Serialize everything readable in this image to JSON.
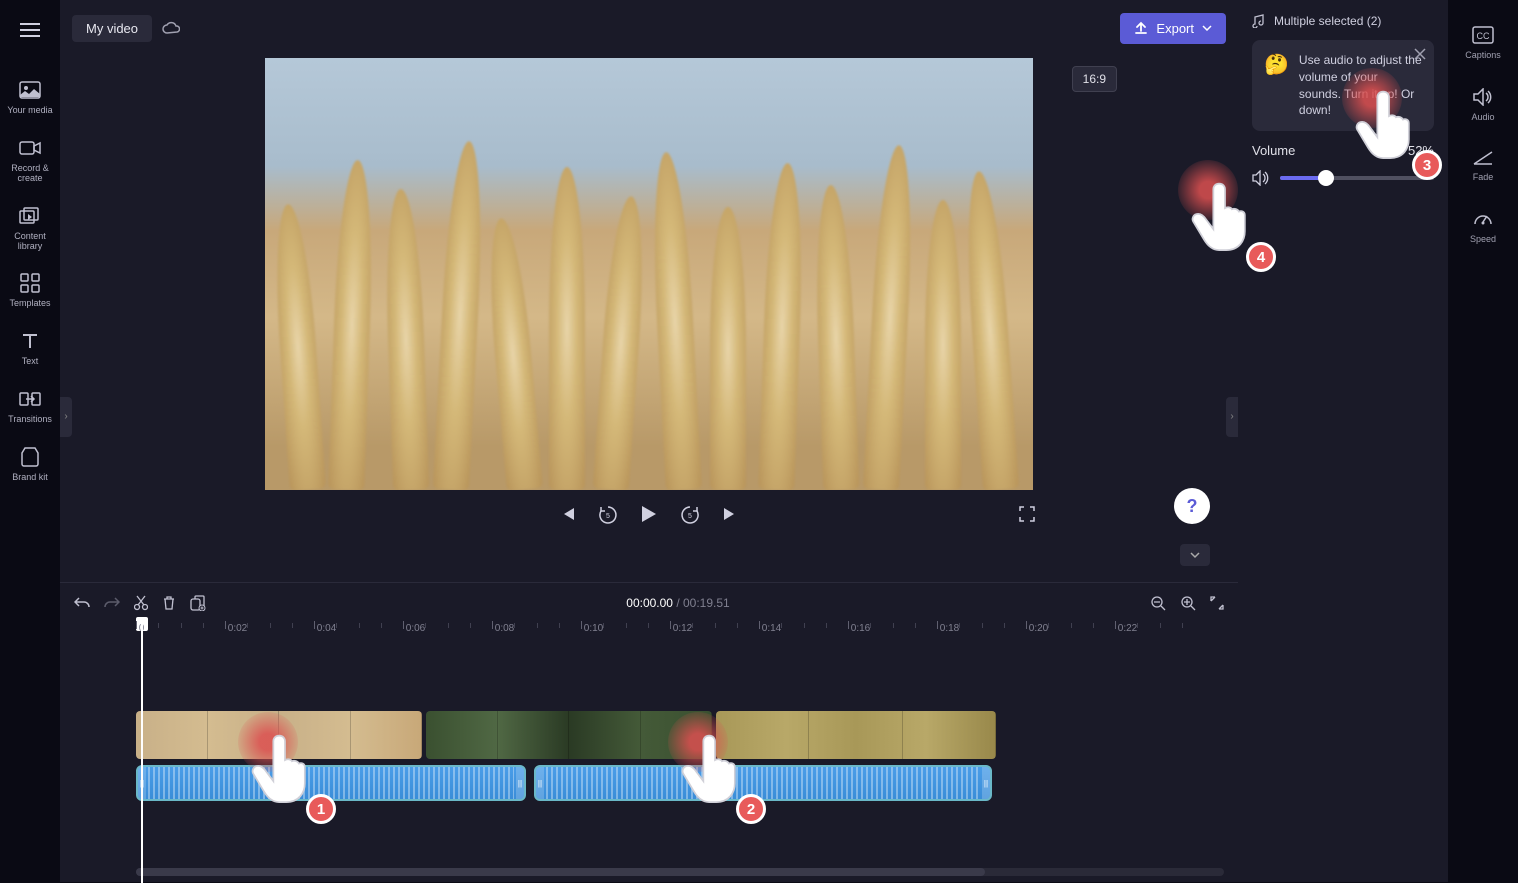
{
  "sidebar": {
    "items": [
      {
        "label": "Your media"
      },
      {
        "label": "Record & create"
      },
      {
        "label": "Content library"
      },
      {
        "label": "Templates"
      },
      {
        "label": "Text"
      },
      {
        "label": "Transitions"
      },
      {
        "label": "Brand kit"
      }
    ]
  },
  "header": {
    "title": "My video",
    "export_label": "Export"
  },
  "preview": {
    "aspect_ratio": "16:9"
  },
  "timeline": {
    "current_time": "00:00.00",
    "total_time": "00:19.51",
    "ticks": [
      "0",
      "0:02",
      "0:04",
      "0:06",
      "0:08",
      "0:10",
      "0:12",
      "0:14",
      "0:16",
      "0:18",
      "0:20",
      "0:22"
    ]
  },
  "panel": {
    "header_text": "Multiple selected (2)",
    "tip_text": "Use audio to adjust the volume of your sounds. Turn it up! Or down!",
    "volume_label": "Volume",
    "volume_value": "52%",
    "volume_percent": 52
  },
  "right_sidebar": {
    "items": [
      {
        "label": "Captions"
      },
      {
        "label": "Audio"
      },
      {
        "label": "Fade"
      },
      {
        "label": "Speed"
      }
    ]
  },
  "annotations": {
    "n1": "1",
    "n2": "2",
    "n3": "3",
    "n4": "4"
  }
}
